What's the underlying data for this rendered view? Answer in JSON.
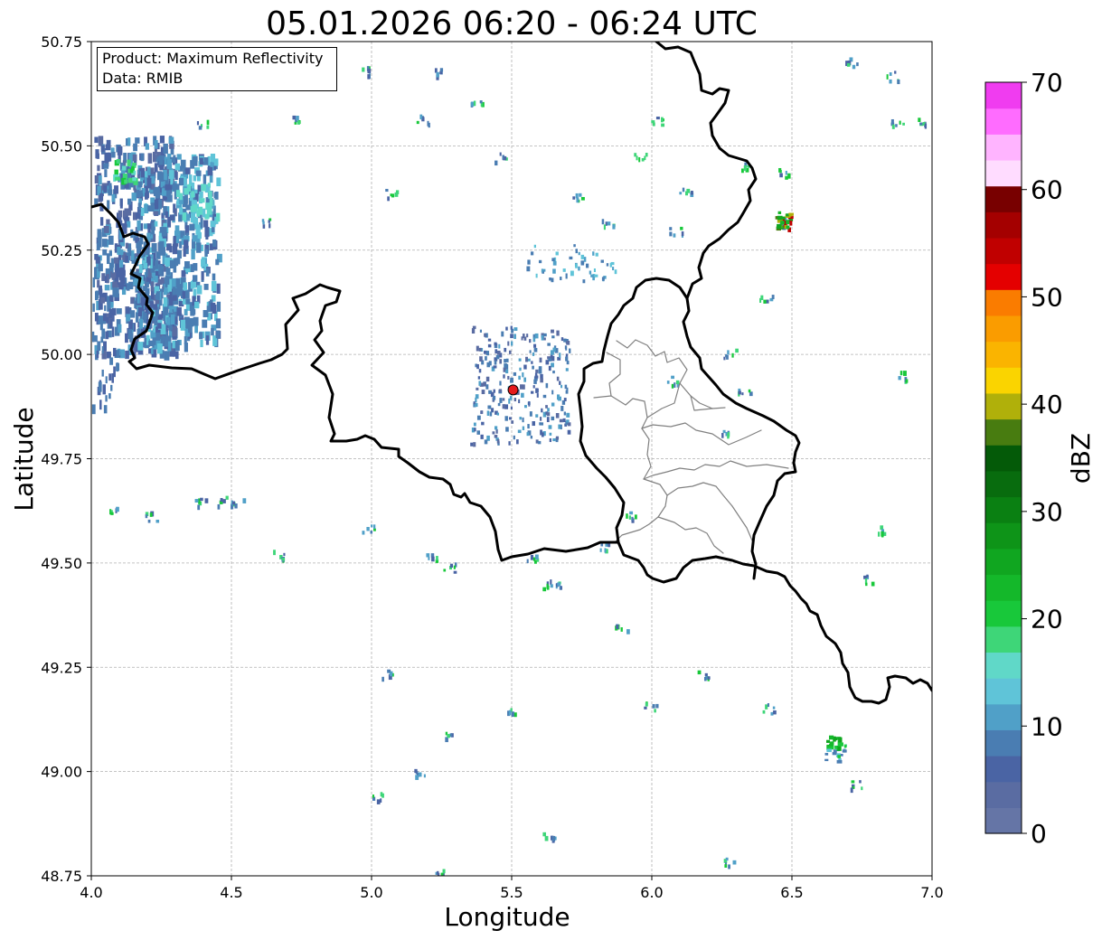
{
  "title": "05.01.2026 06:20 - 06:24 UTC",
  "info": {
    "product": "Product: Maximum Reflectivity",
    "data": "Data: RMIB"
  },
  "axes": {
    "xlabel": "Longitude",
    "ylabel": "Latitude",
    "xlim": [
      4.0,
      7.0
    ],
    "ylim": [
      48.75,
      50.75
    ],
    "xticks": [
      "4.0",
      "4.5",
      "5.0",
      "5.5",
      "6.0",
      "6.5",
      "7.0"
    ],
    "yticks": [
      "48.75",
      "49.00",
      "49.25",
      "49.50",
      "49.75",
      "50.00",
      "50.25",
      "50.50",
      "50.75"
    ],
    "grid": true
  },
  "colorbar": {
    "label": "dBZ",
    "ticks": [
      "0",
      "10",
      "20",
      "30",
      "40",
      "50",
      "60",
      "70"
    ],
    "range": [
      0,
      70
    ],
    "colors": [
      "#6575a6",
      "#5a6ca2",
      "#4a64a4",
      "#4a7db2",
      "#50a0c8",
      "#5fc4d8",
      "#60d8c8",
      "#3ed678",
      "#18c83a",
      "#14b82a",
      "#10a620",
      "#0e9418",
      "#0a8012",
      "#086c0e",
      "#045a08",
      "#487c10",
      "#b0b00a",
      "#fad400",
      "#fab400",
      "#fa9c00",
      "#fa7c00",
      "#e40000",
      "#c00000",
      "#a40000",
      "#780000",
      "#ffdcff",
      "#ffb4ff",
      "#ff6cff",
      "#f03cf0"
    ]
  },
  "radar_site": {
    "lon": 5.505,
    "lat": 49.915,
    "color": "#e41a1c"
  },
  "chart_data": {
    "type": "map",
    "title": "05.01.2026 06:20 - 06:24 UTC",
    "xlabel": "Longitude",
    "ylabel": "Latitude",
    "xlim": [
      4.0,
      7.0
    ],
    "ylim": [
      48.75,
      50.75
    ],
    "units": "dBZ",
    "echo_regions": [
      {
        "lon": [
          4.0,
          4.45
        ],
        "lat": [
          50.02,
          50.52
        ],
        "dbz": "5-20",
        "peak_dbz": 20
      },
      {
        "lon": [
          5.35,
          5.75
        ],
        "lat": [
          49.8,
          50.05
        ],
        "dbz": "0-10"
      },
      {
        "lon": [
          6.42,
          6.5
        ],
        "lat": [
          50.3,
          50.34
        ],
        "dbz": "up to 50",
        "peak_dbz": 50
      },
      {
        "lon": [
          6.62,
          6.68
        ],
        "lat": [
          49.05,
          49.09
        ],
        "dbz": "20-25"
      }
    ],
    "borders": {
      "belgium_france": [
        [
          4.0,
          50.35
        ],
        [
          4.1,
          50.28
        ],
        [
          4.15,
          50.27
        ],
        [
          4.15,
          50.1
        ],
        [
          4.13,
          49.98
        ],
        [
          4.2,
          49.96
        ],
        [
          4.45,
          49.94
        ],
        [
          4.68,
          49.99
        ],
        [
          4.85,
          50.15
        ],
        [
          4.8,
          50.0
        ],
        [
          4.86,
          49.8
        ],
        [
          5.0,
          49.78
        ],
        [
          5.28,
          49.7
        ],
        [
          5.45,
          49.5
        ],
        [
          5.75,
          49.55
        ],
        [
          5.95,
          49.5
        ]
      ],
      "belgium_luxembourg": [
        [
          5.75,
          49.54
        ],
        [
          5.8,
          49.68
        ],
        [
          5.9,
          49.65
        ],
        [
          5.88,
          49.78
        ],
        [
          5.84,
          49.98
        ],
        [
          5.92,
          50.1
        ],
        [
          5.98,
          50.17
        ],
        [
          6.1,
          50.13
        ]
      ],
      "belgium_germany": [
        [
          6.1,
          50.13
        ],
        [
          6.18,
          50.18
        ],
        [
          6.26,
          50.24
        ],
        [
          6.33,
          50.32
        ],
        [
          6.35,
          50.38
        ],
        [
          6.3,
          50.48
        ],
        [
          6.33,
          50.58
        ],
        [
          6.25,
          50.62
        ],
        [
          6.2,
          50.65
        ],
        [
          6.1,
          50.72
        ],
        [
          6.05,
          50.75
        ]
      ],
      "luxembourg_germany": [
        [
          6.1,
          50.13
        ],
        [
          6.12,
          50.0
        ],
        [
          6.25,
          49.88
        ],
        [
          6.42,
          49.8
        ],
        [
          6.48,
          49.73
        ],
        [
          6.45,
          49.68
        ],
        [
          6.38,
          49.57
        ],
        [
          6.37,
          49.46
        ]
      ],
      "france_lux_germany": [
        [
          5.95,
          49.5
        ],
        [
          6.25,
          49.51
        ],
        [
          6.37,
          49.46
        ],
        [
          6.45,
          49.38
        ],
        [
          6.55,
          49.25
        ],
        [
          6.6,
          49.18
        ],
        [
          6.72,
          49.17
        ],
        [
          6.85,
          49.2
        ],
        [
          6.95,
          49.22
        ],
        [
          7.0,
          49.2
        ]
      ]
    }
  }
}
